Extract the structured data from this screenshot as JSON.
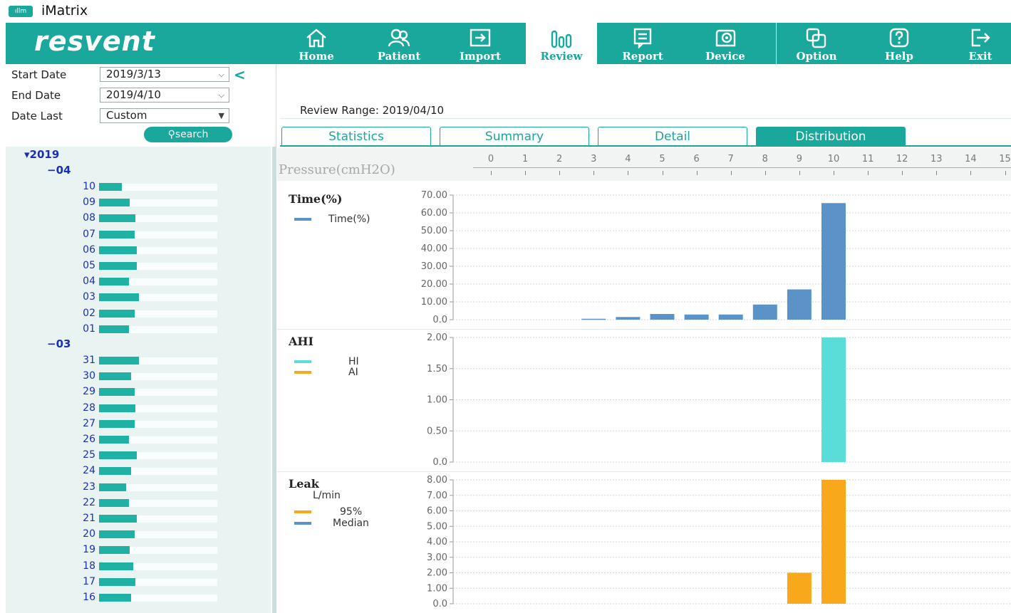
{
  "app": {
    "logo_text": "ıllm",
    "title": "iMatrix"
  },
  "toolbar": {
    "brand": "resvent",
    "buttons": [
      {
        "label": "Home",
        "icon": "home-icon"
      },
      {
        "label": "Patient",
        "icon": "patient-icon"
      },
      {
        "label": "Import",
        "icon": "import-icon"
      },
      {
        "label": "Review",
        "icon": "review-icon",
        "active": true
      },
      {
        "label": "Report",
        "icon": "report-icon"
      },
      {
        "label": "Device",
        "icon": "device-icon"
      },
      {
        "label": "Option",
        "icon": "option-icon"
      },
      {
        "label": "Help",
        "icon": "help-icon"
      },
      {
        "label": "Exit",
        "icon": "exit-icon"
      }
    ]
  },
  "filters": {
    "start_label": "Start Date",
    "start_value": "2019/3/13",
    "end_label": "End Date",
    "end_value": "2019/4/10",
    "last_label": "Date Last",
    "last_value": "Custom",
    "search_label": "search"
  },
  "tree": {
    "year": "2019",
    "months": [
      {
        "label": "04",
        "days": [
          {
            "day": "10",
            "level": 0.19
          },
          {
            "day": "09",
            "level": 0.26
          },
          {
            "day": "08",
            "level": 0.31
          },
          {
            "day": "07",
            "level": 0.3
          },
          {
            "day": "06",
            "level": 0.32
          },
          {
            "day": "05",
            "level": 0.32
          },
          {
            "day": "04",
            "level": 0.25
          },
          {
            "day": "03",
            "level": 0.34
          },
          {
            "day": "02",
            "level": 0.3
          },
          {
            "day": "01",
            "level": 0.25
          }
        ]
      },
      {
        "label": "03",
        "days": [
          {
            "day": "31",
            "level": 0.34
          },
          {
            "day": "30",
            "level": 0.27
          },
          {
            "day": "29",
            "level": 0.3
          },
          {
            "day": "28",
            "level": 0.31
          },
          {
            "day": "27",
            "level": 0.3
          },
          {
            "day": "26",
            "level": 0.25
          },
          {
            "day": "25",
            "level": 0.32
          },
          {
            "day": "24",
            "level": 0.27
          },
          {
            "day": "23",
            "level": 0.23
          },
          {
            "day": "22",
            "level": 0.25
          },
          {
            "day": "21",
            "level": 0.32
          },
          {
            "day": "20",
            "level": 0.3
          },
          {
            "day": "19",
            "level": 0.26
          },
          {
            "day": "18",
            "level": 0.29
          },
          {
            "day": "17",
            "level": 0.31
          },
          {
            "day": "16",
            "level": 0.27
          }
        ]
      }
    ]
  },
  "review": {
    "range_text": "Review Range: 2019/04/10",
    "tabs": [
      "Statistics",
      "Summary",
      "Detail",
      "Distribution"
    ],
    "active_tab": "Distribution",
    "pressure_label": "Pressure(cmH2O)",
    "pressure_ticks": [
      "0",
      "1",
      "2",
      "3",
      "4",
      "5",
      "6",
      "7",
      "8",
      "9",
      "10",
      "11",
      "12",
      "13",
      "14",
      "15"
    ]
  },
  "colors": {
    "accent": "#1aa79c",
    "time": "#5b93c9",
    "hi": "#5adcd8",
    "ai": "#f7a81b",
    "tree_bar": "#1fb1a4"
  },
  "chart_data": [
    {
      "type": "bar",
      "title": "Time(%)",
      "x": [
        0,
        1,
        2,
        3,
        4,
        5,
        6,
        7,
        8,
        9,
        10,
        11,
        12,
        13,
        14,
        15
      ],
      "ylim": [
        0,
        70
      ],
      "y_ticks": [
        "0.0",
        "10.00",
        "20.00",
        "30.00",
        "40.00",
        "50.00",
        "60.00",
        "70.00"
      ],
      "series": [
        {
          "name": "Time(%)",
          "color": "#5b93c9",
          "values": [
            0,
            0,
            0,
            0.5,
            1.5,
            3.2,
            2.9,
            2.9,
            8.5,
            17.0,
            65.5,
            0,
            0,
            0,
            0,
            0
          ]
        }
      ]
    },
    {
      "type": "bar",
      "title": "AHI",
      "x": [
        0,
        1,
        2,
        3,
        4,
        5,
        6,
        7,
        8,
        9,
        10,
        11,
        12,
        13,
        14,
        15
      ],
      "ylim": [
        0,
        2
      ],
      "y_ticks": [
        "0.0",
        "0.50",
        "1.00",
        "1.50",
        "2.00"
      ],
      "series": [
        {
          "name": "HI",
          "color": "#5adcd8",
          "values": [
            0,
            0,
            0,
            0,
            0,
            0,
            0,
            0,
            0,
            0,
            2.0,
            0,
            0,
            0,
            0,
            0
          ]
        },
        {
          "name": "AI",
          "color": "#f7a81b",
          "values": [
            0,
            0,
            0,
            0,
            0,
            0,
            0,
            0,
            0,
            0,
            0,
            0,
            0,
            0,
            0,
            0
          ]
        }
      ]
    },
    {
      "type": "bar",
      "title": "Leak",
      "ylabel": "L/min",
      "x": [
        0,
        1,
        2,
        3,
        4,
        5,
        6,
        7,
        8,
        9,
        10,
        11,
        12,
        13,
        14,
        15
      ],
      "ylim": [
        0,
        8
      ],
      "y_ticks": [
        "0.0",
        "1.00",
        "2.00",
        "3.00",
        "4.00",
        "5.00",
        "6.00",
        "7.00",
        "8.00"
      ],
      "series": [
        {
          "name": "95%",
          "color": "#f7a81b",
          "values": [
            0,
            0,
            0,
            0,
            0,
            0,
            0,
            0,
            0,
            2.0,
            8.0,
            0,
            0,
            0,
            0,
            0
          ]
        },
        {
          "name": "Median",
          "color": "#5b93c9",
          "values": [
            0,
            0,
            0,
            0,
            0,
            0,
            0,
            0,
            0,
            0,
            0,
            0,
            0,
            0,
            0,
            0
          ]
        }
      ]
    }
  ]
}
